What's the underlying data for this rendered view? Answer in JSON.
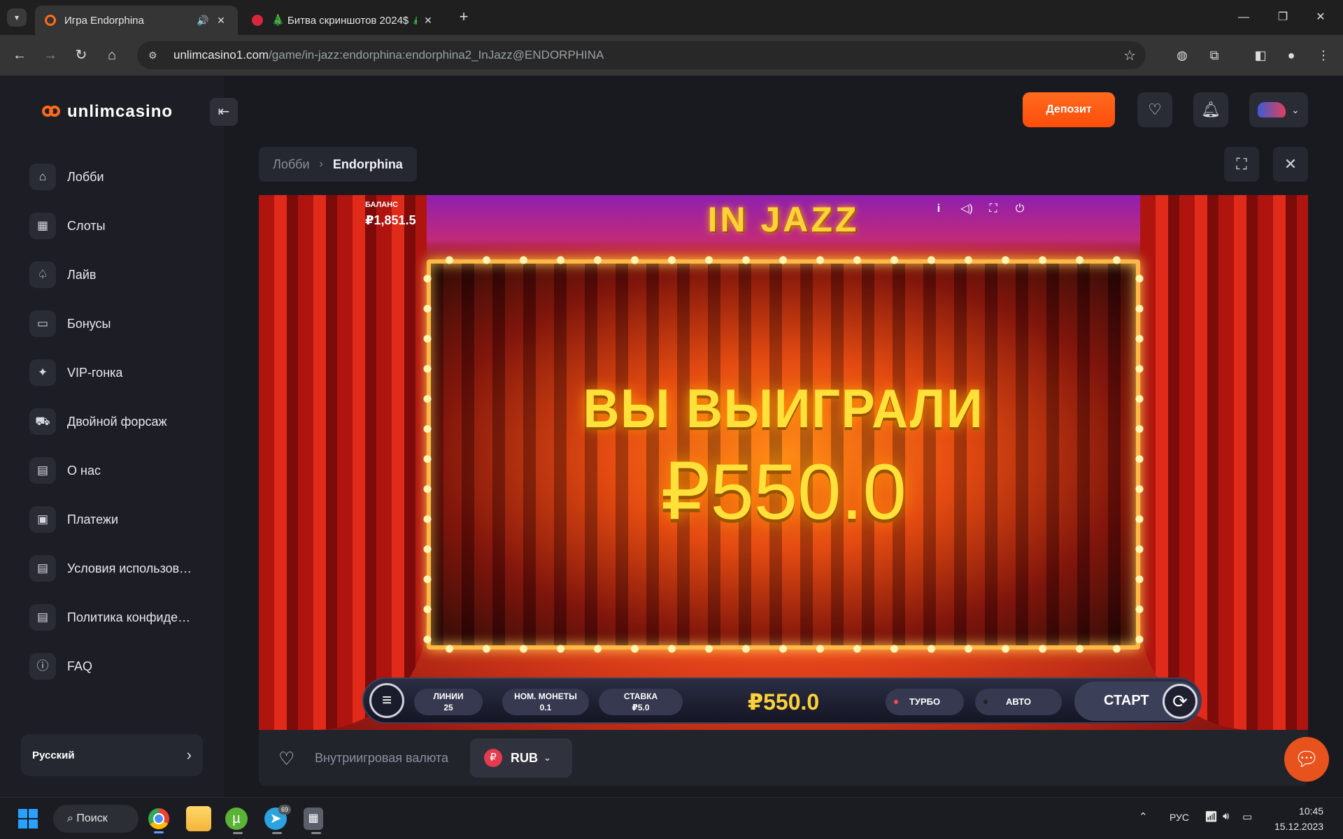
{
  "browser": {
    "tabs": [
      {
        "title": "Игра Endorphina",
        "active": true
      },
      {
        "title": "🎄 Битва скриншотов 2024$ 🎄",
        "active": false
      }
    ],
    "url_host": "unlimcasino1.com",
    "url_path": "/game/in-jazz:endorphina:endorphina2_InJazz@ENDORPHINA"
  },
  "site": {
    "logo_text": "unlimcasino",
    "menu": [
      {
        "label": "Лобби",
        "icon": "home-icon",
        "glyph": "⌂"
      },
      {
        "label": "Слоты",
        "icon": "grid-icon",
        "glyph": "▦"
      },
      {
        "label": "Лайв",
        "icon": "spade-icon",
        "glyph": "♤"
      },
      {
        "label": "Бонусы",
        "icon": "ticket-icon",
        "glyph": "▭"
      },
      {
        "label": "VIP-гонка",
        "icon": "sparkle-icon",
        "glyph": "✦"
      },
      {
        "label": "Двойной форсаж",
        "icon": "car-icon",
        "glyph": "⛟"
      },
      {
        "label": "О нас",
        "icon": "document-icon",
        "glyph": "▤"
      },
      {
        "label": "Платежи",
        "icon": "payment-icon",
        "glyph": "▣"
      },
      {
        "label": "Условия использова...",
        "icon": "document-icon",
        "glyph": "▤"
      },
      {
        "label": "Политика конфиден...",
        "icon": "document-icon",
        "glyph": "▤"
      },
      {
        "label": "FAQ",
        "icon": "info-icon",
        "glyph": "ⓘ"
      }
    ],
    "language": "Русский",
    "deposit_label": "Депозит",
    "breadcrumb": {
      "lobby": "Лобби",
      "current": "Endorphina"
    },
    "footer": {
      "currency_label": "Внутриигровая валюта",
      "currency_code": "RUB",
      "currency_symbol": "₽"
    }
  },
  "game": {
    "title": "IN JAZZ",
    "balance_label": "БАЛАНС",
    "balance_value": "₽1,851.5",
    "win_title": "ВЫ ВЫИГРАЛИ",
    "win_amount": "₽550.0",
    "lines_label": "ЛИНИИ",
    "lines_value": "25",
    "coin_label": "НОМ. МОНЕТЫ",
    "coin_value": "0.1",
    "bet_label": "СТАВКА",
    "bet_value": "₽5.0",
    "panel_win": "₽550.0",
    "turbo_label": "ТУРБО",
    "auto_label": "АВТО",
    "start_label": "СТАРТ"
  },
  "taskbar": {
    "search_label": "Поиск",
    "language": "РУС",
    "telegram_badge": "69",
    "time": "10:45",
    "date": "15.12.2023"
  },
  "colors": {
    "accent": "#ff5a14",
    "win_gold": "#ffe13a",
    "sidebar_bg": "#1d1e25"
  }
}
